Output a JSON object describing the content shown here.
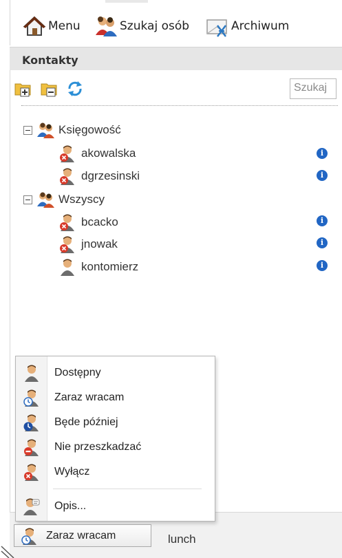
{
  "toolbar": {
    "menu_label": "Menu",
    "search_people_label": "Szukaj osób",
    "archive_label": "Archiwum"
  },
  "contacts": {
    "header": "Kontakty",
    "search_placeholder": "Szukaj",
    "groups": [
      {
        "name": "Księgowość",
        "users": [
          {
            "name": "akowalska",
            "status": "offline"
          },
          {
            "name": "dgrzesinski",
            "status": "offline"
          }
        ]
      },
      {
        "name": "Wszyscy",
        "users": [
          {
            "name": "bcacko",
            "status": "offline"
          },
          {
            "name": "jnowak",
            "status": "offline"
          },
          {
            "name": "kontomierz",
            "status": "available"
          }
        ]
      }
    ]
  },
  "status_menu": {
    "items": [
      {
        "label": "Dostępny",
        "icon": "available-icon"
      },
      {
        "label": "Zaraz wracam",
        "icon": "be-right-back-icon"
      },
      {
        "label": "Będe później",
        "icon": "away-icon"
      },
      {
        "label": "Nie przeszkadzać",
        "icon": "do-not-disturb-icon"
      },
      {
        "label": "Wyłącz",
        "icon": "offline-icon"
      }
    ],
    "description_label": "Opis..."
  },
  "footer": {
    "current_status": "Zaraz wracam",
    "status_description": "lunch"
  },
  "colors": {
    "info": "#2166c4",
    "offline": "#d83a2a",
    "header_bg": "#e6e6e6"
  }
}
